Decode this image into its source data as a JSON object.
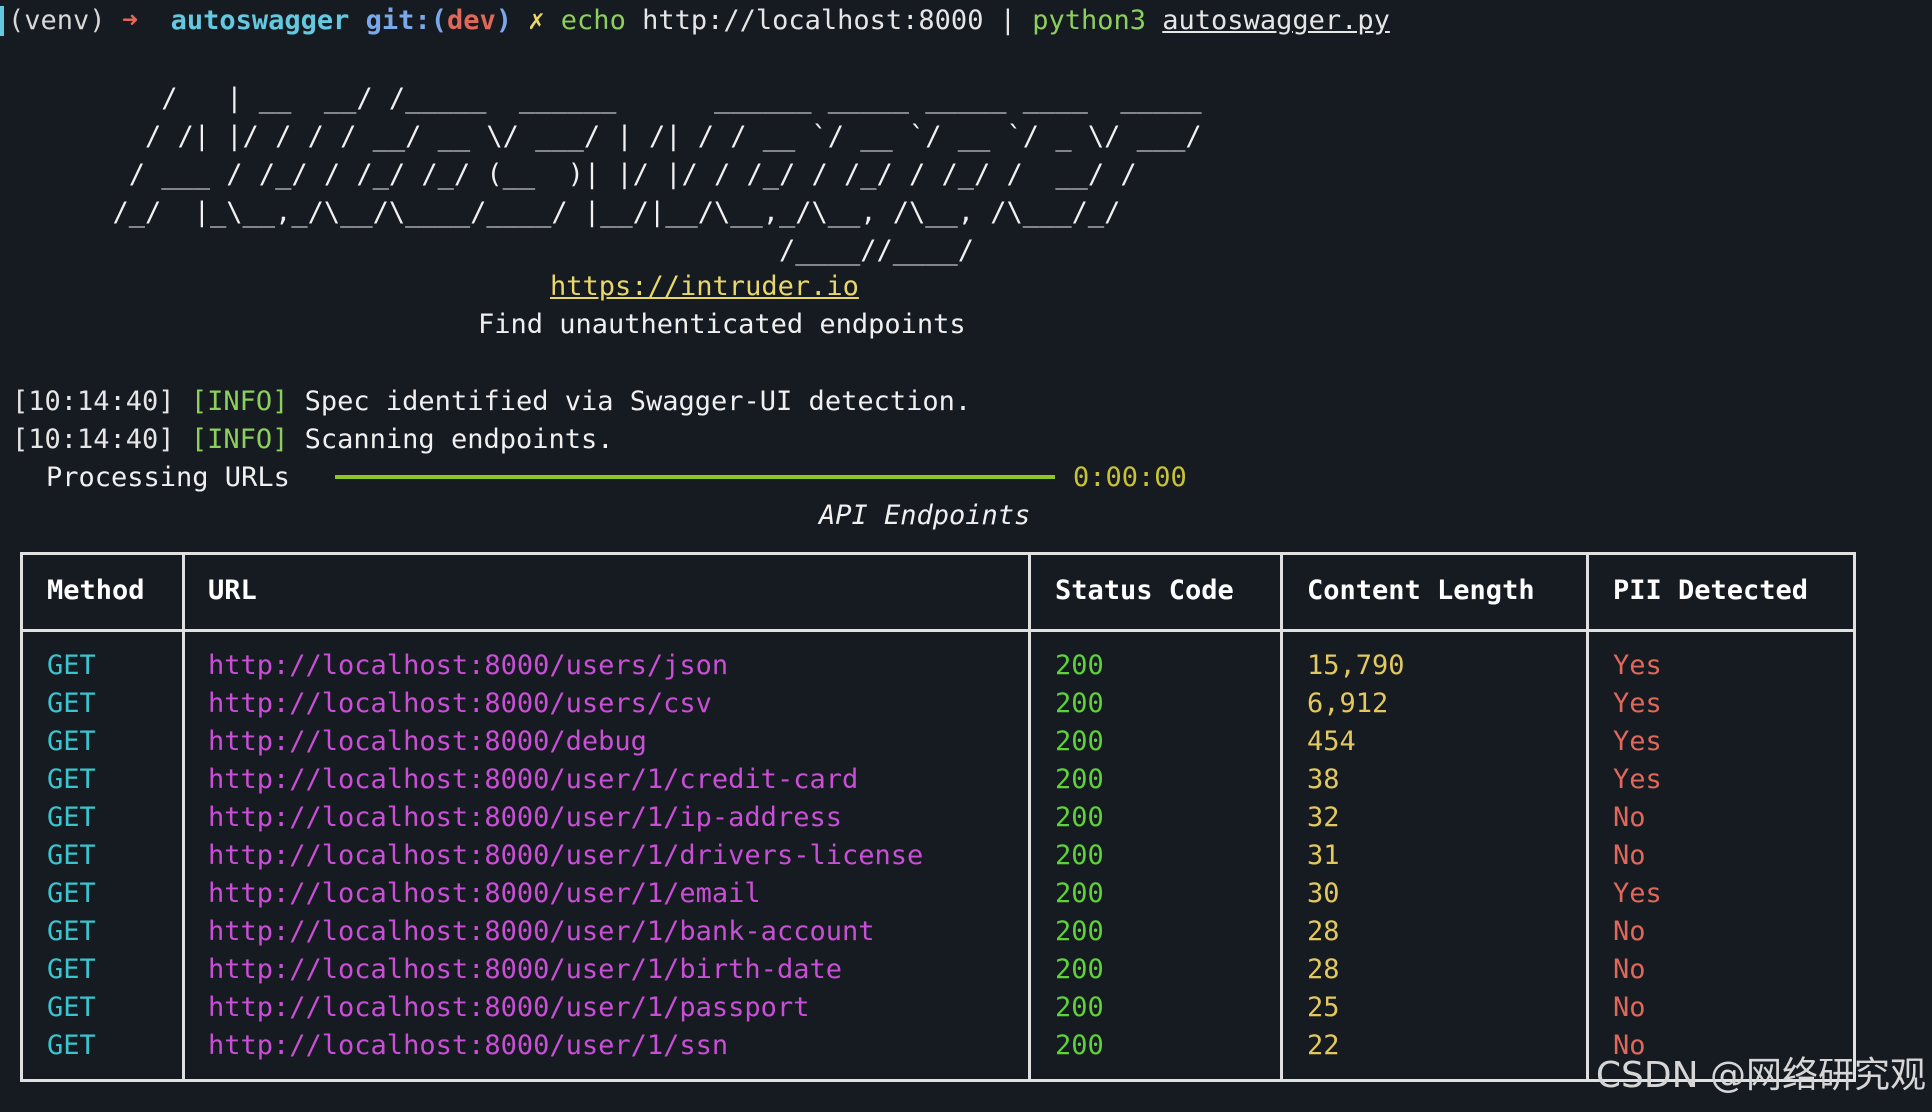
{
  "prompt": {
    "venv": "(venv)",
    "arrow": "➜",
    "repo": "autoswagger",
    "git_label": "git:(",
    "branch": "dev",
    "git_close": ")",
    "dirty": "✗",
    "echo": "echo",
    "echo_arg": " http://localhost:8000 | ",
    "python": "python3",
    "script": "autoswagger.py"
  },
  "banner": {
    "ascii_art": "     /   | __  __/ /_____  ______      ______ _____ _____ ____  _____\n    / /| |/ / / / __/ __ \\/ ___/ | /| / / __ `/ __ `/ __ `/ _ \\/ ___/\n   / ___ / /_/ / /_/ /_/ (__  )| |/ |/ / /_/ / /_/ / /_/ /  __/ /\n  /_/  |_\\__,_/\\__/\\____/____/ |__/|__/\\__,_/\\__, /\\__, /\\___/_/\n                                           /____//____/",
    "link": "https://intruder.io",
    "tagline": "Find unauthenticated endpoints"
  },
  "logs": [
    {
      "time": "[10:14:40]",
      "level": "[INFO]",
      "message": "Spec identified via Swagger-UI detection."
    },
    {
      "time": "[10:14:40]",
      "level": "[INFO]",
      "message": "Scanning endpoints."
    }
  ],
  "progress": {
    "label": "Processing URLs",
    "value": 1.0,
    "time": "0:00:00"
  },
  "table": {
    "caption": "API Endpoints",
    "headers": [
      "Method",
      "URL",
      "Status Code",
      "Content Length",
      "PII Detected"
    ],
    "rows": [
      {
        "method": "GET",
        "url": "http://localhost:8000/users/json",
        "status": "200",
        "length": "15,790",
        "pii": "Yes"
      },
      {
        "method": "GET",
        "url": "http://localhost:8000/users/csv",
        "status": "200",
        "length": "6,912",
        "pii": "Yes"
      },
      {
        "method": "GET",
        "url": "http://localhost:8000/debug",
        "status": "200",
        "length": "454",
        "pii": "Yes"
      },
      {
        "method": "GET",
        "url": "http://localhost:8000/user/1/credit-card",
        "status": "200",
        "length": "38",
        "pii": "Yes"
      },
      {
        "method": "GET",
        "url": "http://localhost:8000/user/1/ip-address",
        "status": "200",
        "length": "32",
        "pii": "No"
      },
      {
        "method": "GET",
        "url": "http://localhost:8000/user/1/drivers-license",
        "status": "200",
        "length": "31",
        "pii": "No"
      },
      {
        "method": "GET",
        "url": "http://localhost:8000/user/1/email",
        "status": "200",
        "length": "30",
        "pii": "Yes"
      },
      {
        "method": "GET",
        "url": "http://localhost:8000/user/1/bank-account",
        "status": "200",
        "length": "28",
        "pii": "No"
      },
      {
        "method": "GET",
        "url": "http://localhost:8000/user/1/birth-date",
        "status": "200",
        "length": "28",
        "pii": "No"
      },
      {
        "method": "GET",
        "url": "http://localhost:8000/user/1/passport",
        "status": "200",
        "length": "25",
        "pii": "No"
      },
      {
        "method": "GET",
        "url": "http://localhost:8000/user/1/ssn",
        "status": "200",
        "length": "22",
        "pii": "No"
      }
    ]
  },
  "watermark": "CSDN @网络研究观",
  "colors": {
    "background": "#161a21",
    "method": "#39c5cf",
    "url": "#c94fd6",
    "status": "#5fd13a",
    "length": "#e2c85e",
    "pii": "#e0685a",
    "progress": "#8fc427"
  }
}
